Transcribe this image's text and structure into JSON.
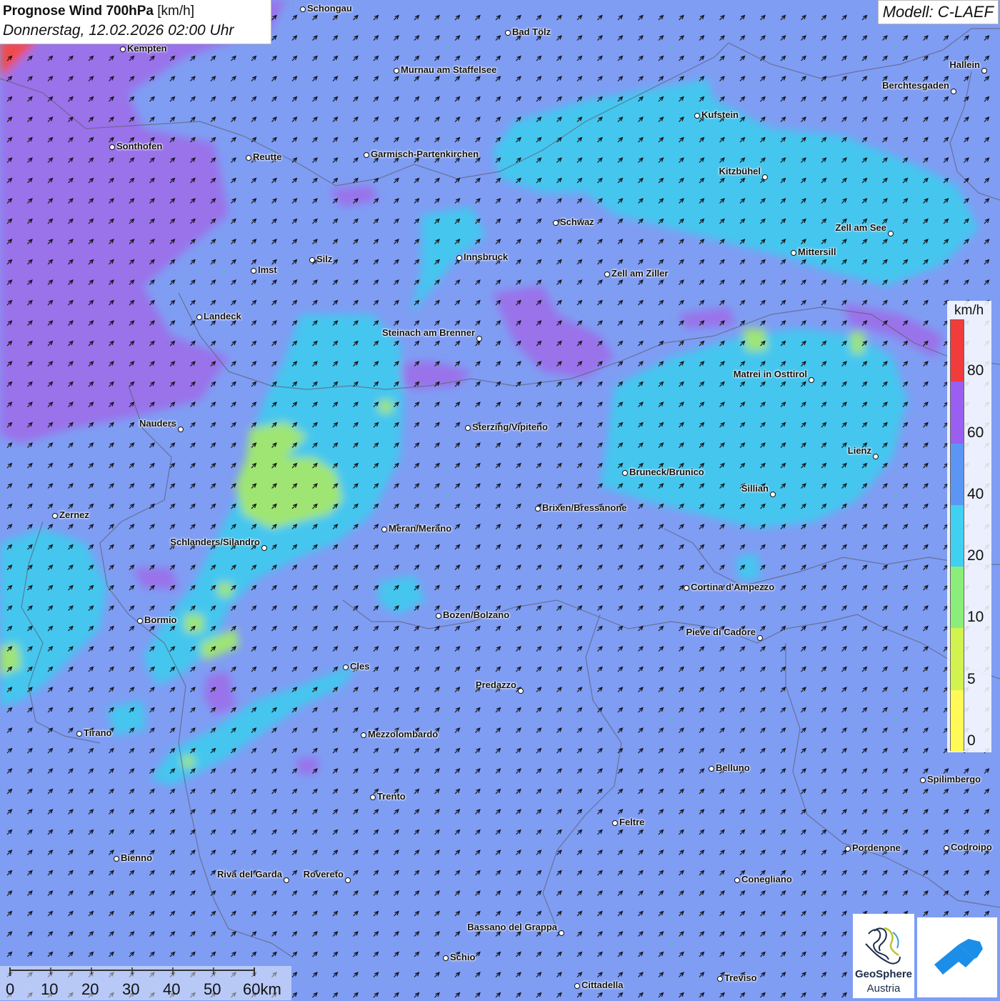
{
  "header": {
    "title_bold": "Prognose Wind 700hPa",
    "title_unit": "[km/h]",
    "datetime": "Donnerstag, 12.02.2026 02:00 Uhr"
  },
  "model": {
    "label": "Modell: C-LAEF"
  },
  "legend": {
    "unit": "km/h",
    "ticks": [
      "0",
      "5",
      "10",
      "20",
      "40",
      "60",
      "80"
    ],
    "colors": [
      "#fffa55",
      "#d2f24f",
      "#8cee7a",
      "#3fd0f2",
      "#5b96f5",
      "#9a5ef0",
      "#f23b3b"
    ]
  },
  "scale": {
    "labels": [
      "0",
      "10",
      "20",
      "30",
      "40",
      "50",
      "60km"
    ]
  },
  "logos": {
    "geosphere_name": "GeoSphere",
    "geosphere_sub": "Austria"
  },
  "wind": {
    "direction_deg_toward": 45,
    "dominant_band": "20-40"
  },
  "cities": [
    {
      "name": "Schongau"
    },
    {
      "name": "Bad Tölz"
    },
    {
      "name": "Kempten"
    },
    {
      "name": "Murnau am Staffelsee"
    },
    {
      "name": "Hallein"
    },
    {
      "name": "Berchtesgaden"
    },
    {
      "name": "Kufstein"
    },
    {
      "name": "Sonthofen"
    },
    {
      "name": "Reutte"
    },
    {
      "name": "Garmisch-Partenkirchen"
    },
    {
      "name": "Kitzbühel"
    },
    {
      "name": "Schwaz"
    },
    {
      "name": "Zell am See"
    },
    {
      "name": "Mittersill"
    },
    {
      "name": "Innsbruck"
    },
    {
      "name": "Silz"
    },
    {
      "name": "Imst"
    },
    {
      "name": "Zell am Ziller"
    },
    {
      "name": "Landeck"
    },
    {
      "name": "Steinach am Brenner"
    },
    {
      "name": "Matrei in Osttirol"
    },
    {
      "name": "Nauders"
    },
    {
      "name": "Sterzing/Vipiteno"
    },
    {
      "name": "Lienz"
    },
    {
      "name": "Bruneck/Brunico"
    },
    {
      "name": "Sillian"
    },
    {
      "name": "Brixen/Bressanone"
    },
    {
      "name": "Zernez"
    },
    {
      "name": "Meran/Merano"
    },
    {
      "name": "Schlanders/Silandro"
    },
    {
      "name": "Cortina d'Ampezzo"
    },
    {
      "name": "Bozen/Bolzano"
    },
    {
      "name": "Bormio"
    },
    {
      "name": "Pieve di Cadore"
    },
    {
      "name": "Cles"
    },
    {
      "name": "Predazzo"
    },
    {
      "name": "Tirano"
    },
    {
      "name": "Mezzolombardo"
    },
    {
      "name": "Belluno"
    },
    {
      "name": "Spilimbergo"
    },
    {
      "name": "Trento"
    },
    {
      "name": "Feltre"
    },
    {
      "name": "Bienno"
    },
    {
      "name": "Pordenone"
    },
    {
      "name": "Codroipo"
    },
    {
      "name": "Riva del Garda"
    },
    {
      "name": "Rovereto"
    },
    {
      "name": "Conegliano"
    },
    {
      "name": "Bassano del Grappa"
    },
    {
      "name": "Schio"
    },
    {
      "name": "Treviso"
    },
    {
      "name": "Cittadella"
    }
  ]
}
